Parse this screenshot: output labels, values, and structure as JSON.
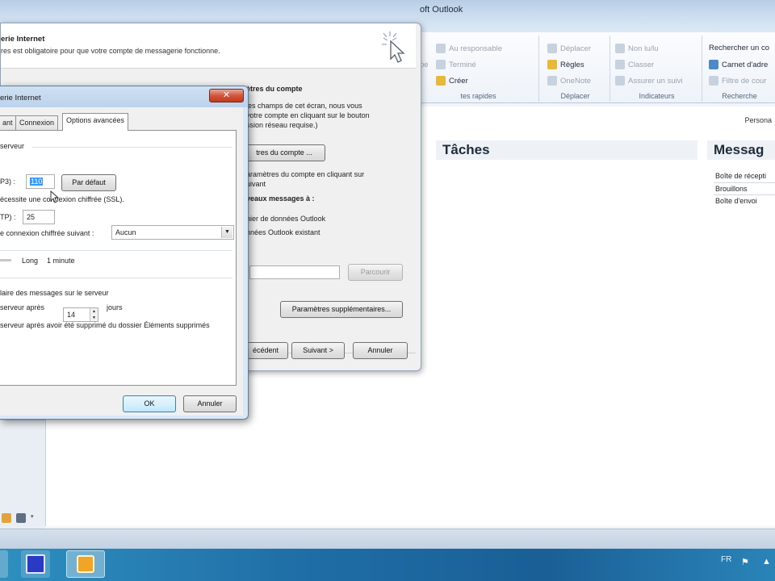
{
  "outlook": {
    "title": "oft Outlook",
    "ribbon": {
      "groups": [
        {
          "label": "tes rapides",
          "items": [
            "pe",
            "Au responsable",
            "Terminé",
            "Créer"
          ]
        },
        {
          "label": "Déplacer",
          "items": [
            "Déplacer",
            "Règles",
            "OneNote"
          ]
        },
        {
          "label": "Indicateurs",
          "items": [
            "Non lu/lu",
            "Classer",
            "Assurer un suivi"
          ]
        },
        {
          "label": "Recherche",
          "items": [
            "Rechercher un co",
            "Carnet d'adre",
            "Filtre de cour"
          ]
        }
      ]
    },
    "persona": "Persona",
    "tasks_title": "Tâches",
    "messages_title": "Messag",
    "message_folders": [
      "Boîte de récepti",
      "Brouillons",
      "Boîte d'envoi"
    ]
  },
  "wizard": {
    "title": "erie Internet",
    "subtitle": "res est obligatoire pour que votre compte de messagerie fonctionne.",
    "section_title": "ètres du compte",
    "desc_lines": [
      "les champs de cet écran, nous vous",
      "votre compte en cliquant sur le bouton",
      "ssion réseau requise.)"
    ],
    "test_button": "tres du compte ...",
    "checkbox_line1": "aramètres du compte en cliquant sur",
    "checkbox_line2": "uivant",
    "deliver_title": "veaux messages à :",
    "option_new": "hier de données Outlook",
    "option_existing": "nnées Outlook existant",
    "browse_button": "Parcourir",
    "more_settings_button": "Paramètres supplémentaires...",
    "back_button": "écédent",
    "next_button": "Suivant >",
    "cancel_button": "Annuler"
  },
  "dialog": {
    "title": "erie Internet",
    "close_glyph": "✕",
    "tabs": [
      "ant",
      "Connexion",
      "Options avancées"
    ],
    "server_section": "serveur",
    "pop_label": "P3) :",
    "pop_value": "110",
    "default_button": "Par défaut",
    "ssl_label": "écessite une connexion chiffrée (SSL).",
    "smtp_label": "TP) :",
    "smtp_value": "25",
    "encryption_label": "e connexion chiffrée suivant :",
    "encryption_value": "Aucun",
    "timeout_long": "Long",
    "timeout_value": "1 minute",
    "keep_copy": "laire des messages sur le serveur",
    "remove_after_prefix": "serveur après",
    "remove_after_days": "14",
    "remove_after_suffix": "jours",
    "remove_deleted": "serveur après avoir été supprimé du dossier Éléments supprimés",
    "ok_button": "OK",
    "cancel_button": "Annuler"
  },
  "taskbar": {
    "language": "FR",
    "flag_glyph": "⚑",
    "tray_glyph": "▲"
  }
}
